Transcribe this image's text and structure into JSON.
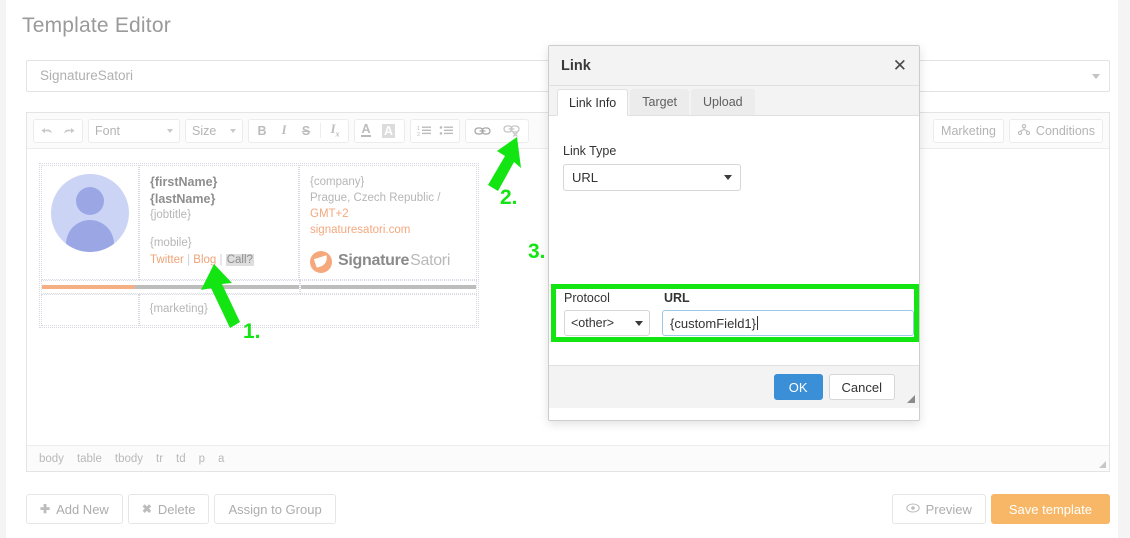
{
  "header": {
    "page_title": "Template Editor"
  },
  "template_name_field": {
    "value": "SignatureSatori",
    "caret_icon": "chevron-down-icon"
  },
  "toolbar": {
    "groups": [
      {
        "items": [
          {
            "name": "undo-icon",
            "label": "",
            "icon": "undo-arrow"
          },
          {
            "name": "redo-icon",
            "label": "",
            "icon": "redo-arrow"
          }
        ]
      }
    ],
    "font_combo": {
      "label": "Font",
      "caret_icon": "caret-down-icon"
    },
    "size_combo": {
      "label": "Size",
      "caret_icon": "caret-down-icon"
    },
    "format_group": [
      {
        "name": "bold-button",
        "label": "B"
      },
      {
        "name": "italic-button",
        "label": "I"
      },
      {
        "name": "strikethrough-button",
        "label": "S"
      },
      {
        "name": "remove-format-button",
        "label": "Ix"
      }
    ],
    "color_group": [
      {
        "name": "text-color-button",
        "label": "A"
      },
      {
        "name": "background-color-button",
        "label": "A"
      }
    ],
    "list_group": [
      {
        "name": "numbered-list-button",
        "label": ""
      },
      {
        "name": "bulleted-list-button",
        "label": ""
      }
    ],
    "link_group": [
      {
        "name": "insert-link-button",
        "label": ""
      },
      {
        "name": "unlink-button",
        "label": ""
      }
    ],
    "right_items": [
      {
        "name": "marketing-button",
        "label": "Marketing"
      },
      {
        "name": "conditions-button",
        "label": "Conditions",
        "icon": "conditions-icon"
      }
    ]
  },
  "signature": {
    "first_name": "{firstName}",
    "last_name": "{lastName}",
    "job_title": "{jobtitle}",
    "mobile": "{mobile}",
    "social_links": [
      {
        "label": "Twitter",
        "selected": false
      },
      {
        "label": "Blog",
        "selected": false
      },
      {
        "label": "Call?",
        "selected": true
      }
    ],
    "separator": "|",
    "company": "{company}",
    "location": "Prague, Czech Republic / ",
    "timezone": "GMT+2",
    "website": "signaturesatori.com",
    "logo": {
      "bold_part": "Signature",
      "light_part": "Satori",
      "mark_icon": "satori-logo-icon"
    },
    "marketing": "{marketing}",
    "colors": {
      "accent": "#f3a87e",
      "rule_gray": "#bdbdbd",
      "rule_orange": "#f6ae83",
      "avatar_bg": "#ccd4f5",
      "avatar_fg": "#9aa7e4"
    }
  },
  "element_path": [
    "body",
    "table",
    "tbody",
    "tr",
    "td",
    "p",
    "a"
  ],
  "bottom_bar": {
    "left_buttons": [
      {
        "name": "add-new-button",
        "glyph": "✚",
        "label": "Add New"
      },
      {
        "name": "delete-button",
        "glyph": "✖",
        "label": "Delete"
      },
      {
        "name": "assign-to-group-button",
        "glyph": "",
        "label": "Assign to Group"
      }
    ],
    "right_buttons": [
      {
        "name": "preview-button",
        "glyph": "◉",
        "label": "Preview"
      },
      {
        "name": "save-template-button",
        "glyph": "",
        "label": "Save template",
        "color": "#f7b767"
      }
    ]
  },
  "dialog": {
    "title": "Link",
    "close_icon": "close-icon",
    "tabs": [
      {
        "label": "Link Info",
        "active": true
      },
      {
        "label": "Target",
        "active": false
      },
      {
        "label": "Upload",
        "active": false
      }
    ],
    "link_type": {
      "label": "Link Type",
      "value": "URL",
      "caret_icon": "caret-down-icon"
    },
    "protocol": {
      "label": "Protocol",
      "value": "<other>",
      "caret_icon": "caret-down-icon"
    },
    "url": {
      "label": "URL",
      "value": "{customField1}"
    },
    "footer": {
      "ok_label": "OK",
      "cancel_label": "Cancel",
      "ok_color": "#3b8fd6"
    },
    "resize_icon": "resize-grip-icon",
    "highlight_color": "#12e512"
  },
  "annotations": [
    {
      "number": "1.",
      "target": "call-link-in-signature"
    },
    {
      "number": "2.",
      "target": "insert-link-toolbar-button"
    },
    {
      "number": "3.",
      "target": "protocol-and-url-fields"
    }
  ]
}
